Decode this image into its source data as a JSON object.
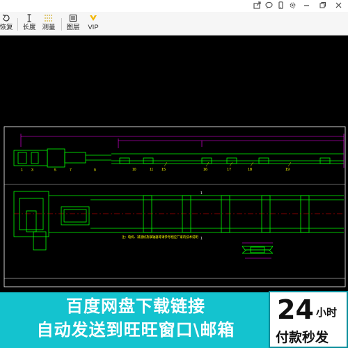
{
  "titlebar": {
    "icons": [
      "share-icon",
      "chat-icon",
      "phone-icon",
      "gear-icon",
      "minimize-icon",
      "restore-icon",
      "close-icon"
    ]
  },
  "toolbar": {
    "items": [
      {
        "label": "恢复",
        "icon": "restore-view-icon"
      },
      {
        "label": "长度",
        "icon": "length-icon"
      },
      {
        "label": "测量",
        "icon": "measure-icon"
      },
      {
        "label": "图层",
        "icon": "layers-icon"
      },
      {
        "label": "VIP",
        "icon": "vip-icon"
      }
    ]
  },
  "drawing": {
    "label_15": "15",
    "label_16": "16",
    "label_17": "17",
    "label_18": "18",
    "label_19": "19",
    "note": "注：电机、减速机及联轴器等请参考相应厂家的技术说明",
    "colors": {
      "frame": "#ffffff",
      "body": "#00ff00",
      "dimension": "#ff00ff",
      "text": "#ffff00",
      "cyan": "#00ffff"
    }
  },
  "banner": {
    "line1": "百度网盘下载链接",
    "line2": "自动发送到旺旺窗口\\邮箱",
    "badge_number": "24",
    "badge_unit": "小时",
    "badge_sub": "付款秒发",
    "color": "#14c3cf"
  }
}
